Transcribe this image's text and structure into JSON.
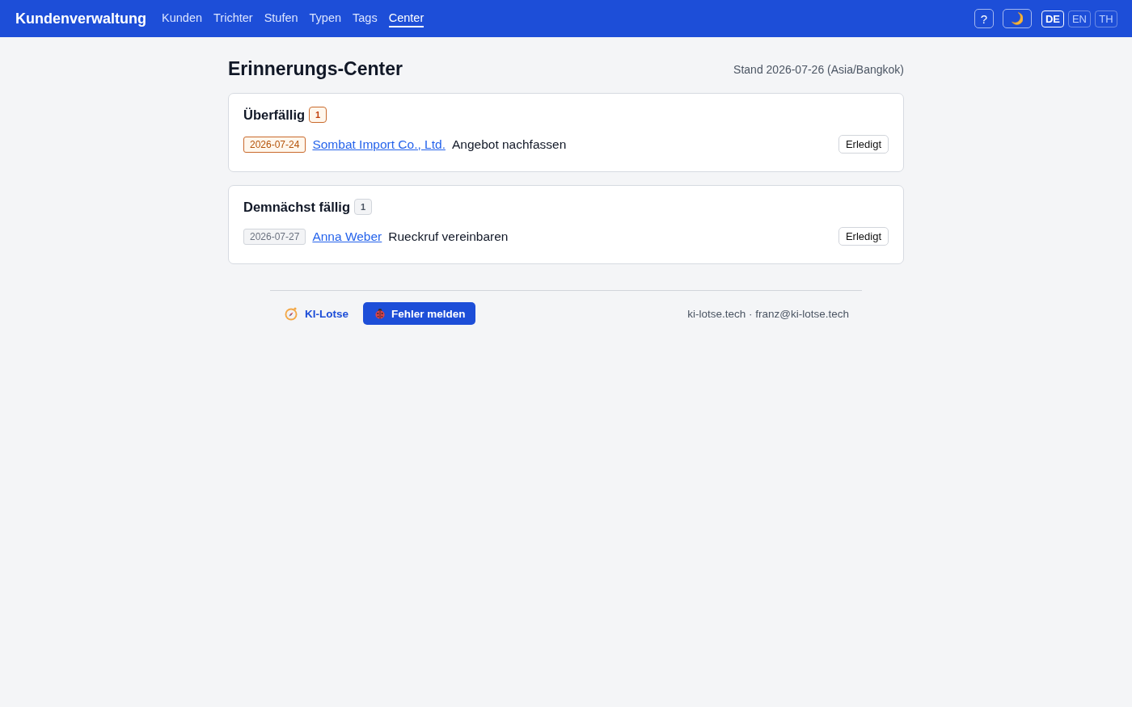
{
  "header": {
    "brand": "Kundenverwaltung",
    "nav": [
      {
        "label": "Kunden",
        "selected": false
      },
      {
        "label": "Trichter",
        "selected": false
      },
      {
        "label": "Stufen",
        "selected": false
      },
      {
        "label": "Typen",
        "selected": false
      },
      {
        "label": "Tags",
        "selected": false
      },
      {
        "label": "Center",
        "selected": true
      }
    ],
    "help_button": "?",
    "languages": [
      {
        "label": "DE",
        "selected": true
      },
      {
        "label": "EN",
        "selected": false
      },
      {
        "label": "TH",
        "selected": false
      }
    ]
  },
  "page": {
    "title": "Erinnerungs-Center",
    "as_of": "Stand 2026-07-26 (Asia/Bangkok)"
  },
  "sections": [
    {
      "kind": "overdue",
      "title": "Überfällig",
      "count": "1",
      "reminders": [
        {
          "date": "2026-07-24",
          "customer": "Sombat Import Co., Ltd.",
          "task": "Angebot nachfassen",
          "action": "Erledigt"
        }
      ]
    },
    {
      "kind": "upcoming",
      "title": "Demnächst fällig",
      "count": "1",
      "reminders": [
        {
          "date": "2026-07-27",
          "customer": "Anna Weber",
          "task": "Rueckruf vereinbaren",
          "action": "Erledigt"
        }
      ]
    }
  ],
  "footer": {
    "brand": "KI-Lotse",
    "report_button": "Fehler melden",
    "contact": "ki-lotse.tech · franz@ki-lotse.tech"
  }
}
